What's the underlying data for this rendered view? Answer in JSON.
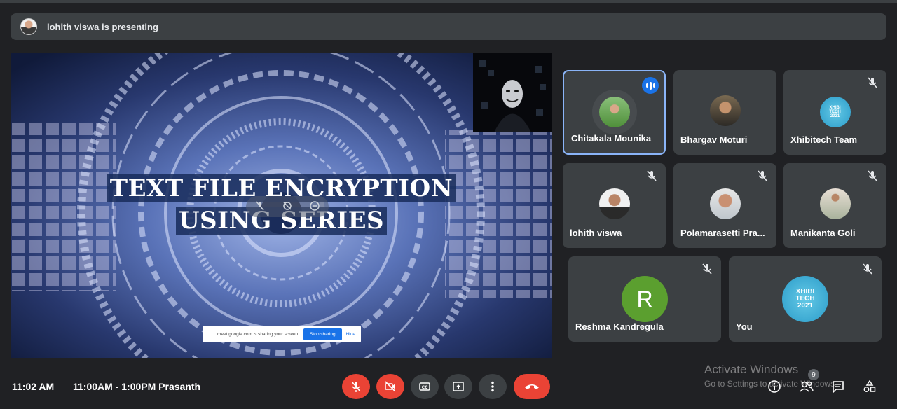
{
  "banner": {
    "text": "lohith viswa is presenting",
    "avatar_icon": "presenter-avatar"
  },
  "presentation": {
    "title_line1": "TEXT FILE ENCRYPTION",
    "title_line2": "USING SERIES",
    "share_bar": {
      "message": "meet.google.com is sharing your screen.",
      "stop_label": "Stop sharing",
      "hide_label": "Hide"
    }
  },
  "participants": [
    {
      "name": "Chitakala Mounika",
      "state": "speaking"
    },
    {
      "name": "Bhargav Moturi",
      "state": "unmuted"
    },
    {
      "name": "Xhibitech Team",
      "state": "muted"
    },
    {
      "name": "lohith viswa",
      "state": "muted"
    },
    {
      "name": "Polamarasetti Pra...",
      "state": "muted"
    },
    {
      "name": "Manikanta Goli",
      "state": "muted"
    },
    {
      "name": "Reshma Kandregula",
      "state": "muted",
      "initial": "R"
    },
    {
      "name": "You",
      "state": "muted"
    }
  ],
  "logo": {
    "line1": "XHIBI",
    "line2": "TECH",
    "line3": "2021"
  },
  "bottom_bar": {
    "time": "11:02 AM",
    "meeting_details": "11:00AM - 1:00PM Prasanth",
    "controls": [
      "mic-off-icon",
      "camera-off-icon",
      "captions-icon",
      "present-icon",
      "more-options-icon",
      "end-call-icon"
    ],
    "right_controls": [
      "info-icon",
      "people-icon",
      "chat-icon",
      "activities-icon"
    ],
    "people_count": "9"
  },
  "watermark": {
    "title": "Activate Windows",
    "subtitle": "Go to Settings to activate Windows."
  },
  "colors": {
    "background": "#202124",
    "tile": "#3c4043",
    "danger": "#ea4335",
    "accent": "#1a73e8",
    "active_border": "#8ab4f8"
  }
}
